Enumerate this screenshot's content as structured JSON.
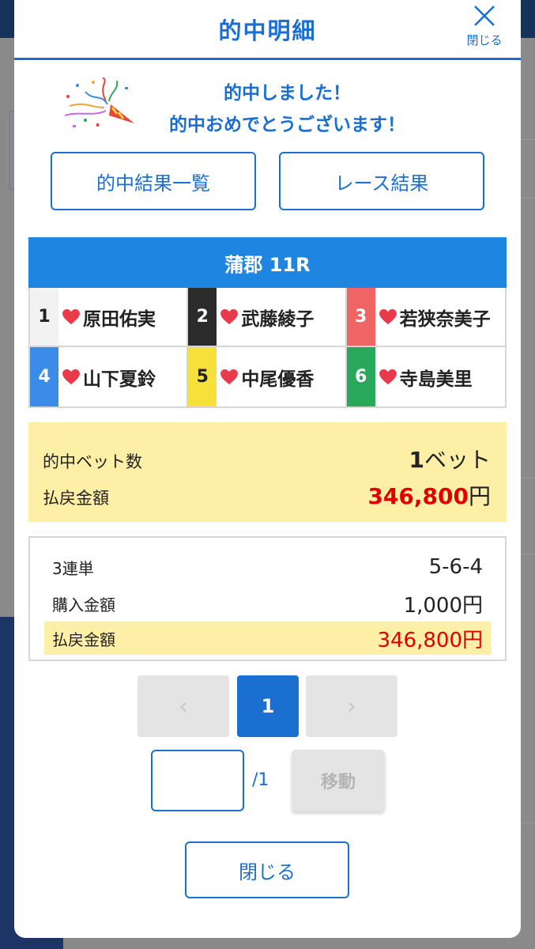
{
  "modal": {
    "title": "的中明細",
    "close_label": "閉じる"
  },
  "congrats": {
    "line1": "的中しました！",
    "line2": "的中おめでとうございます！"
  },
  "buttons": {
    "hit_results_list": "的中結果一覧",
    "race_results": "レース結果"
  },
  "race": {
    "title": "蒲郡 11R",
    "racers": [
      {
        "lane": "1",
        "name": "原田佑実",
        "color": "#f2f2f2",
        "text_color": "#222222"
      },
      {
        "lane": "2",
        "name": "武藤綾子",
        "color": "#2b2b2b",
        "text_color": "#ffffff"
      },
      {
        "lane": "3",
        "name": "若狭奈美子",
        "color": "#ef6464",
        "text_color": "#ffffff"
      },
      {
        "lane": "4",
        "name": "山下夏鈴",
        "color": "#3b8ce8",
        "text_color": "#ffffff"
      },
      {
        "lane": "5",
        "name": "中尾優香",
        "color": "#f6e03a",
        "text_color": "#222222"
      },
      {
        "lane": "6",
        "name": "寺島美里",
        "color": "#2aa85a",
        "text_color": "#ffffff"
      }
    ]
  },
  "summary": {
    "bet_count_label": "的中ベット数",
    "bet_count_value": "1",
    "bet_count_unit": "ベット",
    "payout_label": "払戻金額",
    "payout_value": "346,800",
    "payout_unit": "円"
  },
  "detail": {
    "bet_type": "3連単",
    "combination": "5-6-4",
    "purchase_label": "購入金額",
    "purchase_value": "1,000円",
    "payout_label": "払戻金額",
    "payout_value": "346,800円"
  },
  "pagination": {
    "prev": "‹",
    "current": "1",
    "next": "›",
    "total": "/1",
    "move_label": "移動",
    "input_value": ""
  },
  "footer": {
    "close_label": "閉じる"
  },
  "colors": {
    "accent": "#1a6fd1",
    "race_header": "#1e86e0",
    "highlight": "#fdf0a6",
    "payout_red": "#e10000",
    "heart": "#e83a4a"
  }
}
